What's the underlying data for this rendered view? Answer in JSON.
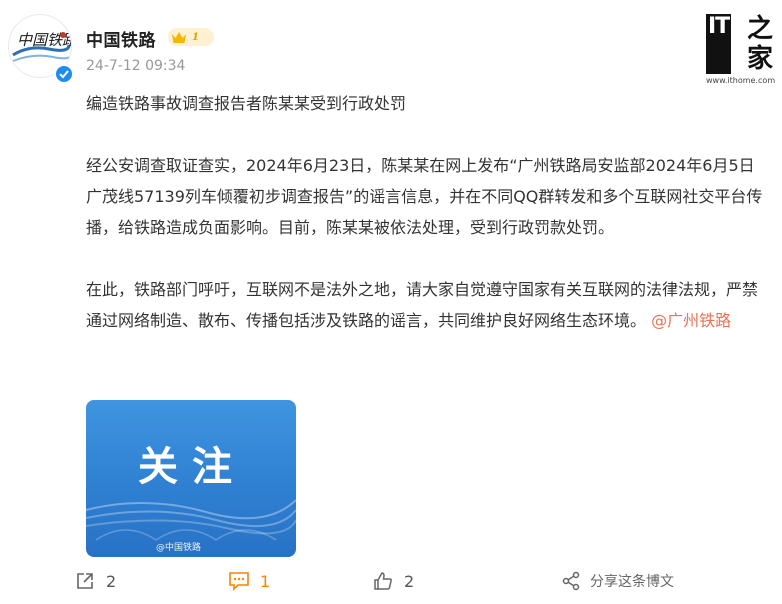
{
  "post": {
    "author": "中国铁路",
    "level": "1",
    "timestamp": "24-7-12 09:34",
    "paragraphs": [
      "编造铁路事故调查报告者陈某某受到行政处罚",
      "经公安调查取证查实，2024年6月23日，陈某某在网上发布“广州铁路局安监部2024年6月5日广茂线57139列车倾覆初步调查报告”的谣言信息，并在不同QQ群转发和多个互联网社交平台传播，给铁路造成负面影响。目前，陈某某被依法处理，受到行政罚款处罚。",
      "在此，铁路部门呼吁，互联网不是法外之地，请大家自觉遵守国家有关互联网的法律法规，严禁通过网络制造、散布、传播包括涉及铁路的谣言，共同维护良好网络生态环境。"
    ],
    "mention": "@广州铁路",
    "image": {
      "title": "关注",
      "watermark": "@中国铁路"
    }
  },
  "site_watermark": {
    "logo_left": "IT",
    "logo_right": "之家",
    "url": "www.ithome.com"
  },
  "actions": {
    "share_count": "2",
    "comment_count": "1",
    "like_count": "2",
    "repost_label": "分享这条博文"
  },
  "colors": {
    "accent": "#ff8200",
    "mention": "#eb7350",
    "verified": "#1e8cf0",
    "image_bg": "#2f80d2"
  },
  "icons": {
    "share": "share-arrow-icon",
    "comment": "comment-bubble-icon",
    "like": "thumbs-up-icon",
    "repost": "share-network-icon",
    "verified": "verified-check-icon",
    "level": "crown-icon"
  }
}
